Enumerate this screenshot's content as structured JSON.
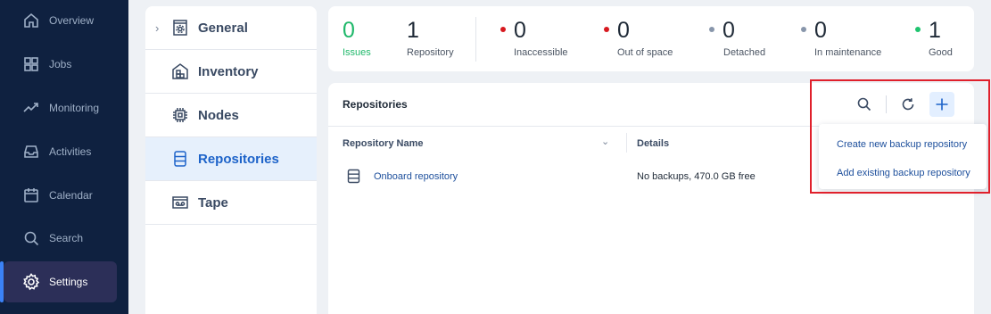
{
  "nav": {
    "items": [
      {
        "label": "Overview",
        "icon": "home-icon"
      },
      {
        "label": "Jobs",
        "icon": "grid-icon"
      },
      {
        "label": "Monitoring",
        "icon": "pulse-icon"
      },
      {
        "label": "Activities",
        "icon": "inbox-icon"
      },
      {
        "label": "Calendar",
        "icon": "calendar-icon"
      },
      {
        "label": "Search",
        "icon": "search-icon"
      },
      {
        "label": "Settings",
        "icon": "gear-icon"
      }
    ],
    "active": "Settings"
  },
  "categories": {
    "items": [
      {
        "label": "General",
        "icon": "gear-box-icon"
      },
      {
        "label": "Inventory",
        "icon": "inventory-icon"
      },
      {
        "label": "Nodes",
        "icon": "chip-icon"
      },
      {
        "label": "Repositories",
        "icon": "repository-icon"
      },
      {
        "label": "Tape",
        "icon": "tape-icon"
      }
    ],
    "active": "Repositories"
  },
  "stats": {
    "issues": {
      "value": "0",
      "label": "Issues"
    },
    "repository": {
      "value": "1",
      "label": "Repository"
    },
    "inaccessible": {
      "value": "0",
      "label": "Inaccessible"
    },
    "out_of_space": {
      "value": "0",
      "label": "Out of space"
    },
    "detached": {
      "value": "0",
      "label": "Detached"
    },
    "in_maintenance": {
      "value": "0",
      "label": "In maintenance"
    },
    "good": {
      "value": "1",
      "label": "Good"
    }
  },
  "colors": {
    "issues": "#1fb86a",
    "error_dot": "#d7191f",
    "neutral_dot": "#8896ab",
    "good_dot": "#1fc46f",
    "accent": "#1d63c9",
    "highlight_box": "#e0202b"
  },
  "repositories": {
    "title": "Repositories",
    "columns": {
      "name": "Repository Name",
      "details": "Details"
    },
    "rows": [
      {
        "name": "Onboard repository",
        "details": "No backups, 470.0 GB free"
      }
    ]
  },
  "add_menu": {
    "items": [
      "Create new backup repository",
      "Add existing backup repository"
    ]
  }
}
